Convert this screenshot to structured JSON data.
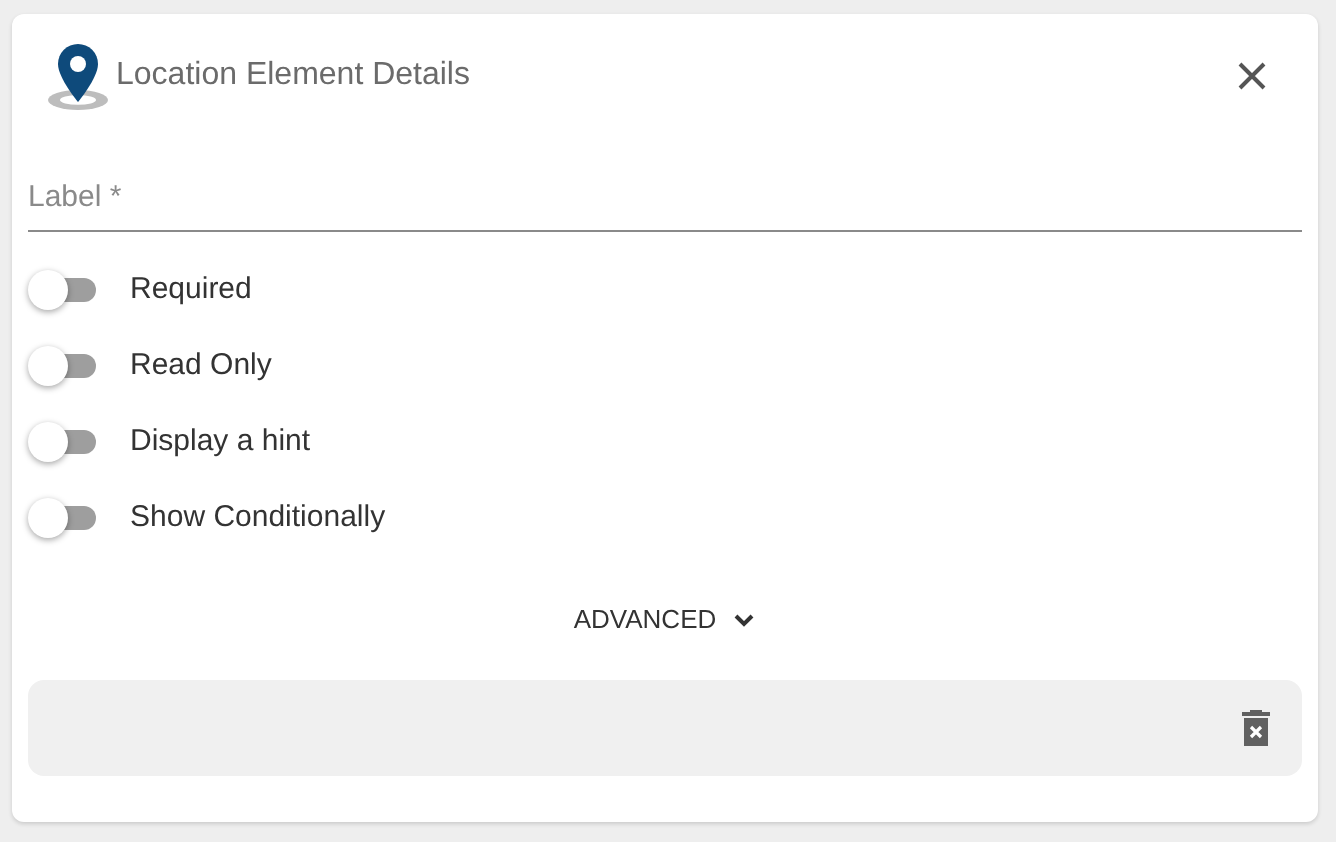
{
  "dialog": {
    "title": "Location Element Details"
  },
  "label_field": {
    "placeholder": "Label *"
  },
  "toggles": [
    {
      "label": "Required",
      "on": false
    },
    {
      "label": "Read Only",
      "on": false
    },
    {
      "label": "Display a hint",
      "on": false
    },
    {
      "label": "Show Conditionally",
      "on": false
    }
  ],
  "advanced": {
    "label": "ADVANCED",
    "expanded": false
  }
}
